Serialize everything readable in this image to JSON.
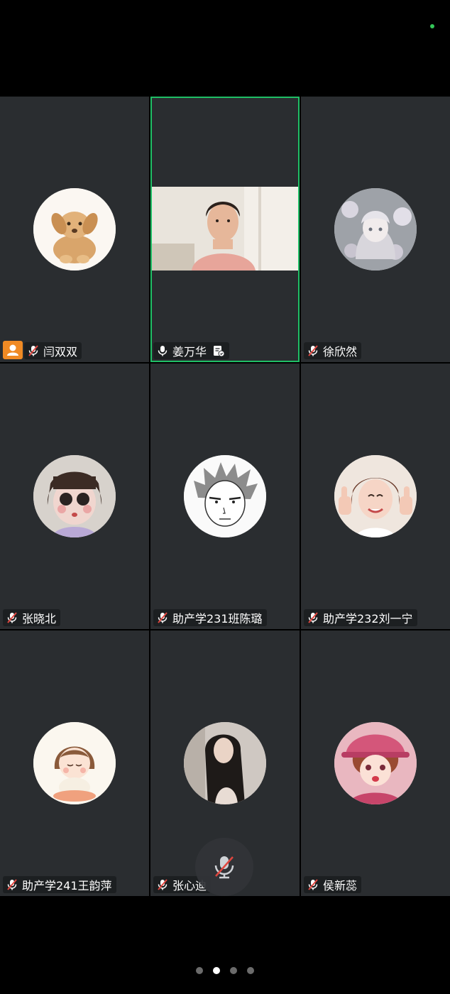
{
  "colors": {
    "active_border": "#1fbf66",
    "host_badge": "#f08a24",
    "status_dot": "#34c759",
    "muted_slash": "#e0463f"
  },
  "participants": [
    {
      "name": "闫双双",
      "host": true,
      "muted": true,
      "avatar": "dog-avatar"
    },
    {
      "name": "姜万华",
      "host": false,
      "muted": false,
      "speaking": true,
      "video": "webcam-feed",
      "sharing_icon": "screen-share-icon"
    },
    {
      "name": "徐欣然",
      "host": false,
      "muted": true,
      "avatar": "anime-girl-flowers-avatar"
    },
    {
      "name": "张晓北",
      "host": false,
      "muted": true,
      "avatar": "doll-avatar"
    },
    {
      "name": "助产学231班陈璐",
      "host": false,
      "muted": true,
      "avatar": "manga-boy-avatar"
    },
    {
      "name": "助产学232刘一宁",
      "host": false,
      "muted": true,
      "avatar": "thumbs-up-girl-avatar"
    },
    {
      "name": "助产学241王韵萍",
      "host": false,
      "muted": true,
      "avatar": "cartoon-girl-avatar"
    },
    {
      "name": "张心迪",
      "host": false,
      "muted": true,
      "avatar": "long-hair-photo-avatar"
    },
    {
      "name": "侯新蕊",
      "host": false,
      "muted": true,
      "avatar": "pink-hat-anime-avatar"
    }
  ],
  "controls": {
    "mute_button_icon": "mic-muted-icon"
  },
  "pager": {
    "total": 4,
    "current": 2
  }
}
